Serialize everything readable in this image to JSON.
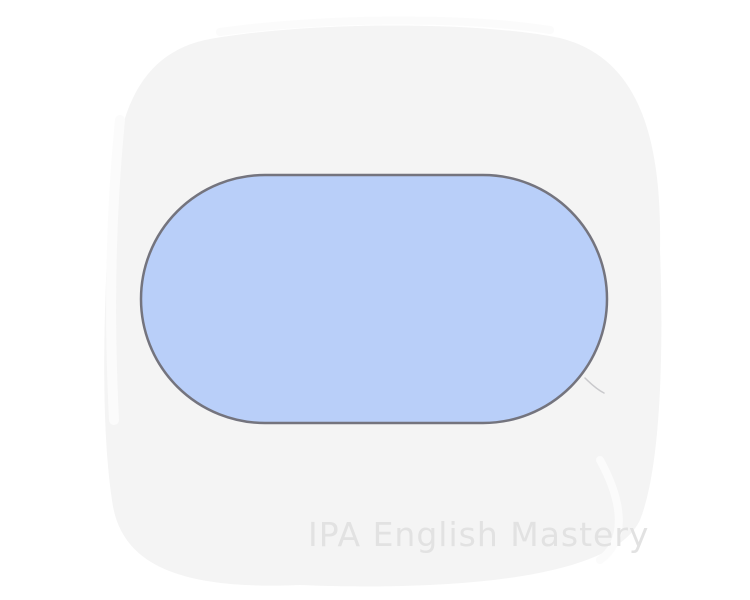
{
  "watermark": {
    "text": "IPA English Mastery"
  },
  "illustration": {
    "shape": "stadium",
    "fill_color": "#b9cff9",
    "stroke_color": "#74747e",
    "background_blob_color": "#f4f4f4",
    "page_background": "#ffffff"
  }
}
